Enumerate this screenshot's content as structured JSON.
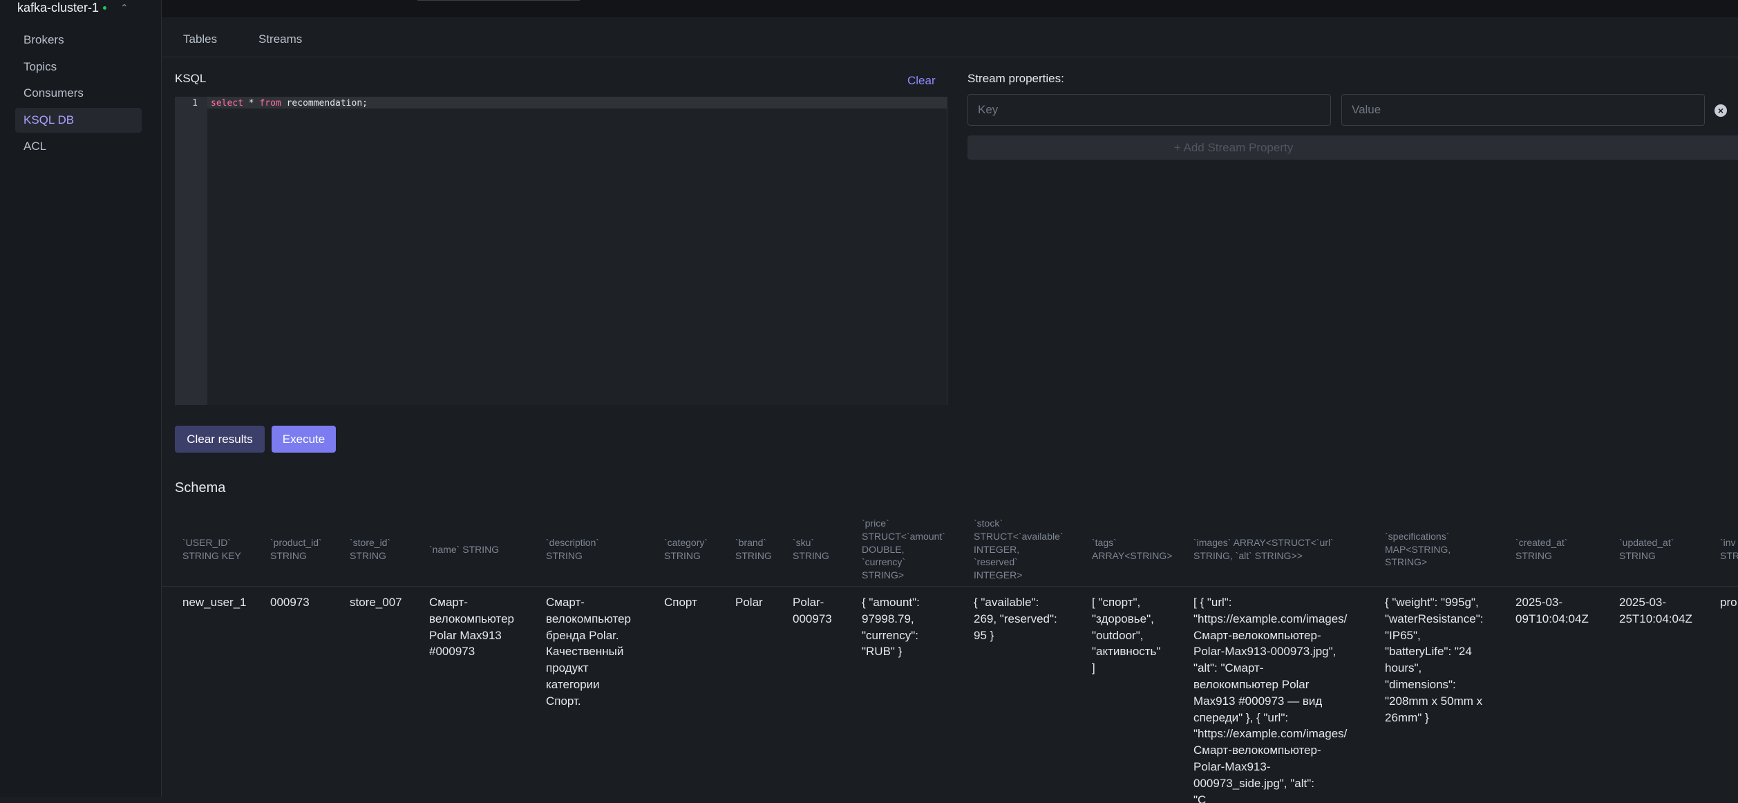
{
  "sidebar": {
    "cluster_name": "kafka-cluster-1",
    "items": [
      {
        "label": "Brokers"
      },
      {
        "label": "Topics"
      },
      {
        "label": "Consumers"
      },
      {
        "label": "KSQL DB"
      },
      {
        "label": "ACL"
      }
    ]
  },
  "tabs": [
    {
      "label": "Tables"
    },
    {
      "label": "Streams"
    }
  ],
  "editor": {
    "label": "KSQL",
    "clear_label": "Clear",
    "line_number": "1",
    "query_kw1": "select",
    "query_mid": " * ",
    "query_kw2": "from",
    "query_rest": " recommendation;"
  },
  "stream_properties": {
    "label": "Stream properties:",
    "key_placeholder": "Key",
    "value_placeholder": "Value",
    "add_label": "+ Add Stream Property"
  },
  "buttons": {
    "clear_results": "Clear results",
    "execute": "Execute"
  },
  "schema": {
    "label": "Schema",
    "headers": [
      "`USER_ID`\nSTRING KEY",
      "`product_id`\nSTRING",
      "`store_id`\nSTRING",
      "`name` STRING",
      "`description`\nSTRING",
      "`category`\nSTRING",
      "`brand`\nSTRING",
      "`sku`\nSTRING",
      "`price`\nSTRUCT<`amount`\nDOUBLE,\n`currency`\nSTRING>",
      "`stock`\nSTRUCT<`available`\nINTEGER,\n`reserved`\nINTEGER>",
      "`tags`\nARRAY<STRING>",
      "`images` ARRAY<STRUCT<`url`\nSTRING, `alt` STRING>>",
      "`specifications`\nMAP<STRING,\nSTRING>",
      "`created_at`\nSTRING",
      "`updated_at`\nSTRING",
      "`inv\nSTR"
    ],
    "row": [
      "new_user_1",
      "000973",
      "store_007",
      "Смарт-\nвелокомпьютер\nPolar Max913\n#000973",
      "Смарт-\nвелокомпьютер\nбренда Polar.\nКачественный\nпродукт\nкатегории\nСпорт.",
      "Спорт",
      "Polar",
      "Polar-\n000973",
      "{ \"amount\":\n97998.79,\n\"currency\":\n\"RUB\" }",
      "{ \"available\":\n269, \"reserved\":\n95 }",
      "[ \"спорт\",\n\"здоровье\",\n\"outdoor\",\n\"активность\"\n]",
      "[ { \"url\":\n\"https://example.com/images/\nСмарт-велокомпьютер-\nPolar-Max913-000973.jpg\",\n\"alt\": \"Смарт-\nвелокомпьютер Polar\nMax913 #000973 — вид\nспереди\" }, { \"url\":\n\"https://example.com/images/\nСмарт-велокомпьютер-\nPolar-Max913-\n000973_side.jpg\", \"alt\":\n\"С",
      "{ \"weight\": \"995g\",\n\"waterResistance\":\n\"IP65\",\n\"batteryLife\": \"24\nhours\",\n\"dimensions\":\n\"208mm x 50mm x\n26mm\" }",
      "2025-03-\n09T10:04:04Z",
      "2025-03-\n25T10:04:04Z",
      "pro"
    ]
  }
}
